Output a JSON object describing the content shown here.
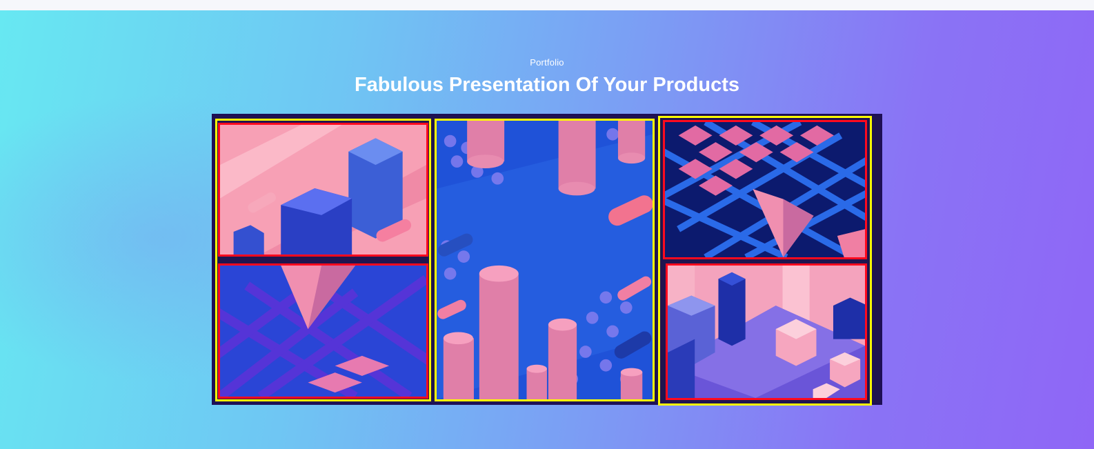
{
  "section": {
    "eyebrow": "Portfolio",
    "title": "Fabulous Presentation Of Your Products"
  },
  "portfolio": {
    "items": [
      {
        "name": "portfolio-item-hexagons",
        "icon": "isometric-hexagons-image"
      },
      {
        "name": "portfolio-item-pyramid-grid",
        "icon": "isometric-pyramid-grid-image"
      },
      {
        "name": "portfolio-item-cylinders",
        "icon": "isometric-cylinders-image"
      },
      {
        "name": "portfolio-item-diamond-grid",
        "icon": "isometric-diamond-grid-image"
      },
      {
        "name": "portfolio-item-cubes",
        "icon": "isometric-cubes-image"
      }
    ]
  },
  "colors": {
    "highlight_yellow": "#ffff00",
    "highlight_red": "#ff0a1e",
    "frame": "#1e0f55",
    "pink": "#f58cab",
    "blue": "#1f4fd8",
    "navy": "#0c1a6e"
  }
}
